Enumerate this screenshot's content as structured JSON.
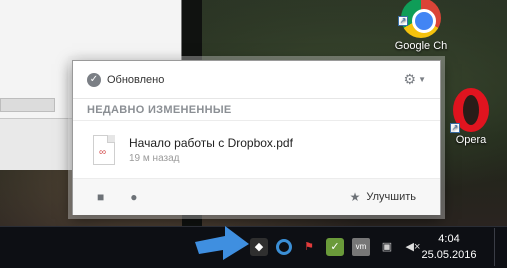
{
  "popup": {
    "status": "Обновлено",
    "section_title": "НЕДАВНО ИЗМЕНЕННЫЕ",
    "file": {
      "name": "Начало работы с Dropbox.pdf",
      "time": "19 м назад"
    },
    "footer": {
      "upgrade_label": "Улучшить"
    }
  },
  "desktop": {
    "icons": [
      {
        "label": "Google Ch",
        "icon": "chrome-icon"
      },
      {
        "label": "Opera",
        "icon": "opera-icon"
      }
    ]
  },
  "taskbar": {
    "clock": {
      "time": "4:04",
      "date": "25.05.2016"
    },
    "vm_label": "vm"
  },
  "colors": {
    "arrow": "#3f8fe0",
    "taskbar": "#0d0f14",
    "popup_bg": "#ffffff"
  }
}
